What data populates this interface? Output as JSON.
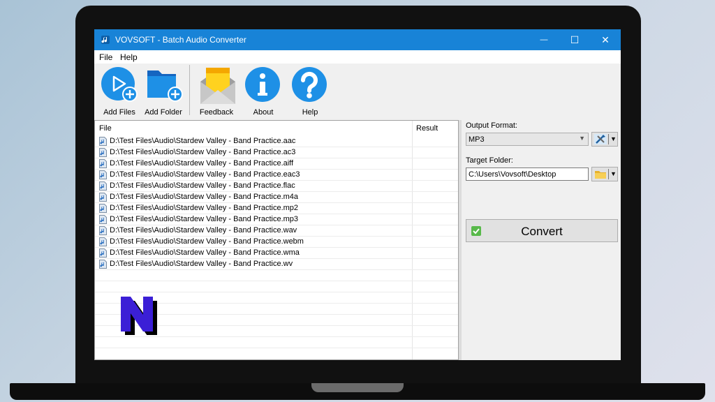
{
  "window": {
    "title": "VOVSOFT - Batch Audio Converter",
    "minimize_glyph": "—",
    "maximize_glyph": "☐",
    "close_glyph": "✕"
  },
  "menu": {
    "items": [
      "File",
      "Help"
    ]
  },
  "toolbar": {
    "buttons": [
      {
        "label": "Add Files",
        "icon": "play-add-icon"
      },
      {
        "label": "Add Folder",
        "icon": "folder-add-icon"
      },
      {
        "label": "Feedback",
        "icon": "envelope-icon"
      },
      {
        "label": "About",
        "icon": "info-icon"
      },
      {
        "label": "Help",
        "icon": "question-icon"
      }
    ]
  },
  "file_list": {
    "columns": [
      "File",
      "Result"
    ],
    "rows": [
      "D:\\Test Files\\Audio\\Stardew Valley - Band Practice.aac",
      "D:\\Test Files\\Audio\\Stardew Valley - Band Practice.ac3",
      "D:\\Test Files\\Audio\\Stardew Valley - Band Practice.aiff",
      "D:\\Test Files\\Audio\\Stardew Valley - Band Practice.eac3",
      "D:\\Test Files\\Audio\\Stardew Valley - Band Practice.flac",
      "D:\\Test Files\\Audio\\Stardew Valley - Band Practice.m4a",
      "D:\\Test Files\\Audio\\Stardew Valley - Band Practice.mp2",
      "D:\\Test Files\\Audio\\Stardew Valley - Band Practice.mp3",
      "D:\\Test Files\\Audio\\Stardew Valley - Band Practice.wav",
      "D:\\Test Files\\Audio\\Stardew Valley - Band Practice.webm",
      "D:\\Test Files\\Audio\\Stardew Valley - Band Practice.wma",
      "D:\\Test Files\\Audio\\Stardew Valley - Band Practice.wv"
    ]
  },
  "settings": {
    "output_format_label": "Output Format:",
    "output_format_value": "MP3",
    "target_folder_label": "Target Folder:",
    "target_folder_value": "C:\\Users\\Vovsoft\\Desktop",
    "convert_label": "Convert"
  },
  "colors": {
    "titlebar": "#1883d7",
    "icon_blue": "#1e90e6",
    "convert_check": "#58b94a",
    "watermark": "#3b1fd6"
  }
}
